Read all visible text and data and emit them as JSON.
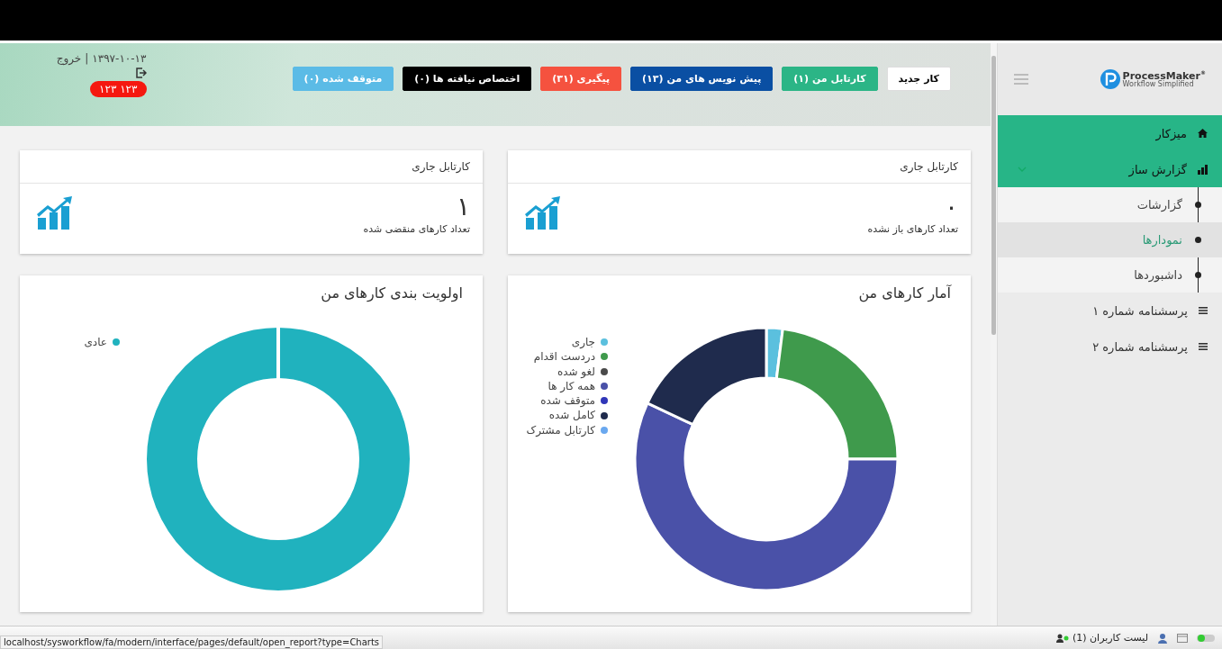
{
  "header": {
    "date": "۱۳۹۷-۱۰-۱۳",
    "separator": "|",
    "logout": "خروج",
    "user_badge": "۱۲۳ ۱۲۳",
    "buttons": [
      {
        "label": "کار جدید",
        "kind": "outline",
        "color": "#ffffff"
      },
      {
        "label": "کارتابل من (۱)",
        "kind": "solid",
        "color": "#2bb586"
      },
      {
        "label": "پیش نویس های من (۱۳)",
        "kind": "solid",
        "color": "#0a4fa3"
      },
      {
        "label": "پیگیری (۳۱)",
        "kind": "solid",
        "color": "#f5523f"
      },
      {
        "label": "اختصاص نیافته ها (۰)",
        "kind": "solid",
        "color": "#000000"
      },
      {
        "label": "متوقف شده (۰)",
        "kind": "solid",
        "color": "#5bbbe6"
      }
    ]
  },
  "sidebar": {
    "logo": {
      "name": "ProcessMaker",
      "mark": "®",
      "tagline": "Workflow Simplified"
    },
    "items": [
      {
        "label": "میزکار",
        "kind": "home",
        "active": true
      },
      {
        "label": "گزارش ساز",
        "kind": "chart",
        "active": true,
        "expanded": true,
        "children": [
          {
            "label": "گزارشات",
            "selected": false
          },
          {
            "label": "نمودارها",
            "selected": true
          },
          {
            "label": "داشبوردها",
            "selected": false
          }
        ]
      },
      {
        "label": "پرسشنامه شماره ۱",
        "kind": "list",
        "active": false
      },
      {
        "label": "پرسشنامه شماره ۲",
        "kind": "list",
        "active": false
      }
    ]
  },
  "stat_cards": [
    {
      "title": "کارتابل جاری",
      "value": "۰",
      "caption": "تعداد کارهای باز نشده"
    },
    {
      "title": "کارتابل جاری",
      "value": "۱",
      "caption": "تعداد کارهای منقضی شده"
    }
  ],
  "chart_cards": [
    {
      "title": "آمار کارهای من",
      "legend": [
        {
          "label": "جاری",
          "color": "#5bc0de"
        },
        {
          "label": "دردست اقدام",
          "color": "#3f9a4c"
        },
        {
          "label": "لغو شده",
          "color": "#4a4a4a"
        },
        {
          "label": "همه کار ها",
          "color": "#4a51a8"
        },
        {
          "label": "متوقف شده",
          "color": "#3036b8"
        },
        {
          "label": "کامل شده",
          "color": "#1f2b4d"
        },
        {
          "label": "کارتابل مشترک",
          "color": "#6aa8ef"
        }
      ]
    },
    {
      "title": "اولویت بندی کارهای من",
      "legend": [
        {
          "label": "عادی",
          "color": "#20b2be"
        }
      ]
    }
  ],
  "status_bar": {
    "url": "localhost/sysworkflow/fa/modern/interface/pages/default/open_report?type=Charts",
    "users": "لیست کاربران (1)"
  }
}
